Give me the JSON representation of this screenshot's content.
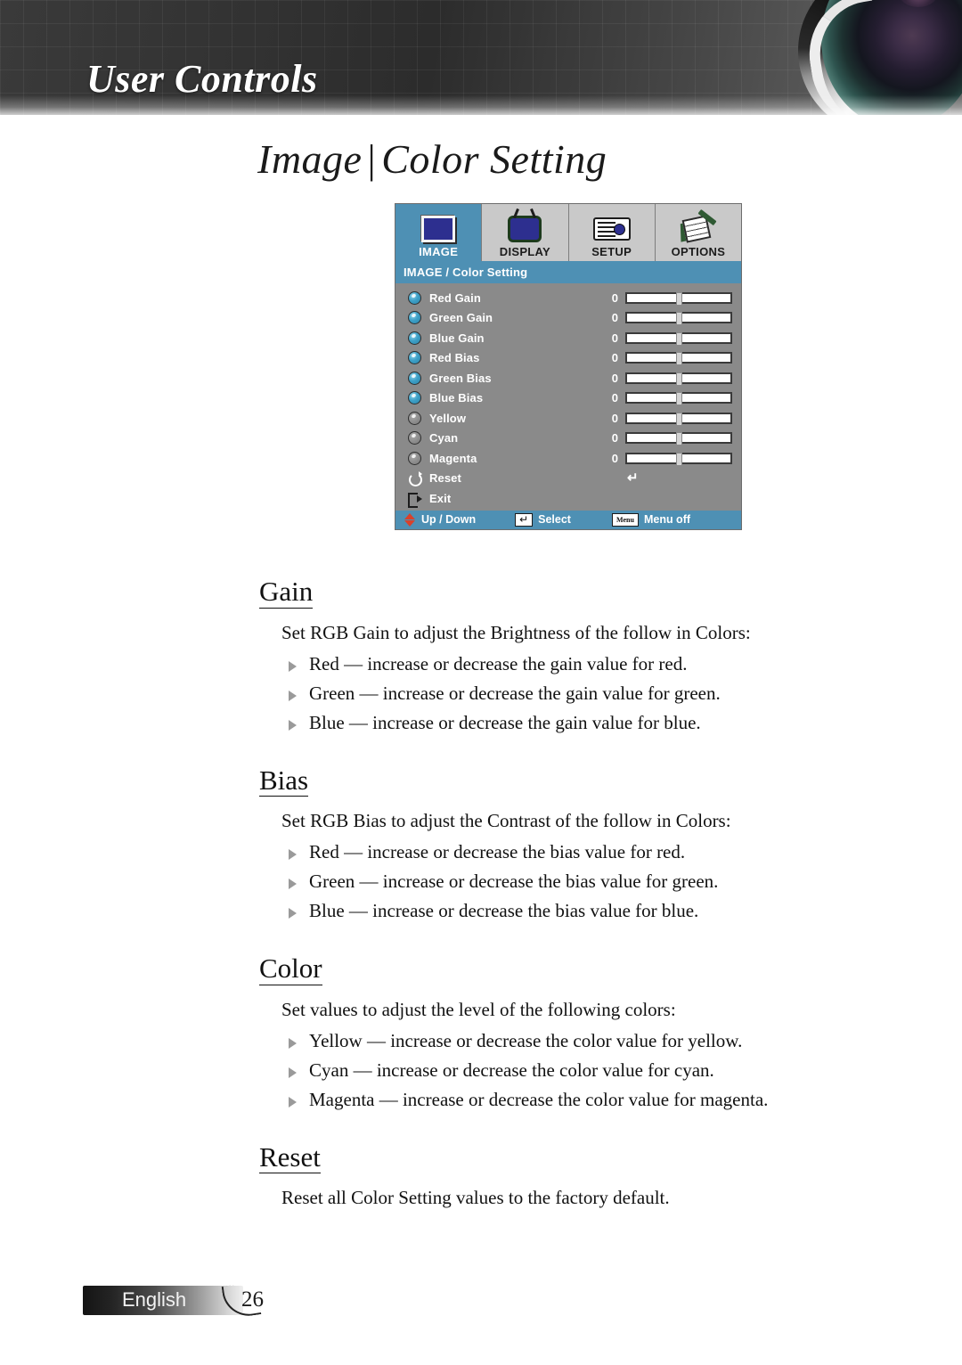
{
  "banner": {
    "title": "User Controls",
    "lens_icon": "camera-lens-graphic"
  },
  "page_title": {
    "left": "Image",
    "separator": "|",
    "right": "Color Setting"
  },
  "osd": {
    "tabs": [
      {
        "label": "IMAGE",
        "icon": "monitor-icon",
        "active": true
      },
      {
        "label": "DISPLAY",
        "icon": "tv-icon",
        "active": false
      },
      {
        "label": "SETUP",
        "icon": "projector-icon",
        "active": false
      },
      {
        "label": "OPTIONS",
        "icon": "clipboard-pencil-icon",
        "active": false
      }
    ],
    "subtitle": "IMAGE / Color Setting",
    "rows": [
      {
        "label": "Red Gain",
        "value": "0",
        "icon": "knob-on-icon",
        "control": "slider"
      },
      {
        "label": "Green Gain",
        "value": "0",
        "icon": "knob-on-icon",
        "control": "slider"
      },
      {
        "label": "Blue Gain",
        "value": "0",
        "icon": "knob-on-icon",
        "control": "slider"
      },
      {
        "label": "Red Bias",
        "value": "0",
        "icon": "knob-on-icon",
        "control": "slider"
      },
      {
        "label": "Green Bias",
        "value": "0",
        "icon": "knob-on-icon",
        "control": "slider"
      },
      {
        "label": "Blue Bias",
        "value": "0",
        "icon": "knob-on-icon",
        "control": "slider"
      },
      {
        "label": "Yellow",
        "value": "0",
        "icon": "knob-off-icon",
        "control": "slider"
      },
      {
        "label": "Cyan",
        "value": "0",
        "icon": "knob-off-icon",
        "control": "slider"
      },
      {
        "label": "Magenta",
        "value": "0",
        "icon": "knob-off-icon",
        "control": "slider"
      },
      {
        "label": "Reset",
        "value": "",
        "icon": "reset-arrow-icon",
        "control": "enter",
        "glyph": "↵"
      },
      {
        "label": "Exit",
        "value": "",
        "icon": "exit-door-icon",
        "control": "none"
      }
    ],
    "footer": {
      "updown_label": "Up / Down",
      "updown_icon": "up-down-arrows-icon",
      "select_label": "Select",
      "select_icon": "enter-key-icon",
      "select_glyph": "↵",
      "menuoff_label": "Menu off",
      "menuoff_icon": "menu-key-icon",
      "menuoff_key": "Menu"
    },
    "colors": {
      "accent_blue": "#4e90b4",
      "panel_gray": "#8a8a8a",
      "tab_gray": "#c9c9c9"
    }
  },
  "sections": [
    {
      "heading": "Gain",
      "intro": "Set RGB Gain to adjust the Brightness of the follow in Colors:",
      "bullets": [
        "Red — increase or decrease the gain value for red.",
        "Green — increase or decrease the gain value for green.",
        "Blue — increase or decrease the gain value for blue."
      ]
    },
    {
      "heading": "Bias",
      "intro": "Set RGB Bias to adjust the Contrast of the follow in Colors:",
      "bullets": [
        "Red — increase or decrease the bias value for red.",
        "Green — increase or decrease the bias value for green.",
        "Blue — increase or decrease the bias value for blue."
      ]
    },
    {
      "heading": "Color",
      "intro": "Set values to adjust the level of the following colors:",
      "bullets": [
        "Yellow — increase or decrease the color value for yellow.",
        "Cyan — increase or decrease the color value for cyan.",
        "Magenta — increase or decrease the color value for magenta."
      ]
    },
    {
      "heading": "Reset",
      "intro": "Reset all Color Setting values to the factory default.",
      "bullets": []
    }
  ],
  "footer": {
    "language": "English",
    "page_number": "26"
  }
}
